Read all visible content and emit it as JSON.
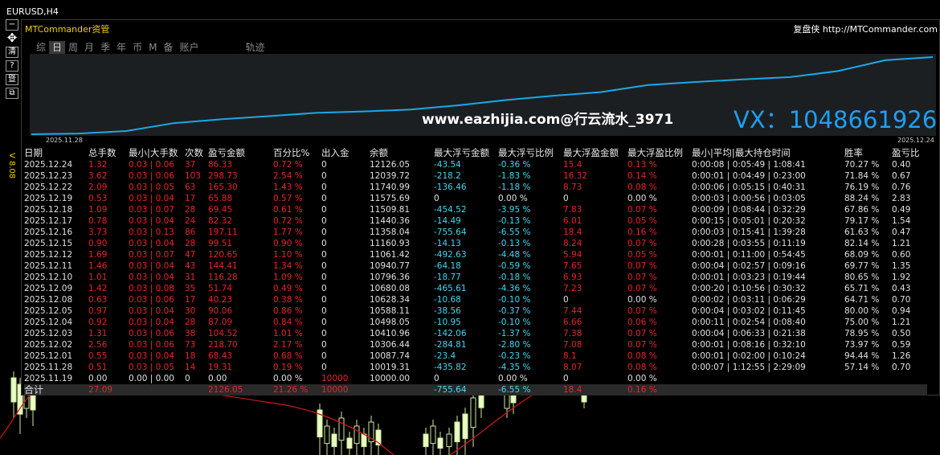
{
  "window": {
    "symbol_title": "EURUSD,H4"
  },
  "panel": {
    "title": "MTCommander资管",
    "link_prefix": "复盘侠",
    "link_url": "http://MTCommander.com",
    "version": "V 8.08"
  },
  "sidebar": {
    "buttons": [
      "−",
      "✥",
      "清",
      "?",
      "暨",
      "⧉"
    ]
  },
  "tabs": [
    {
      "label": "综",
      "active": false
    },
    {
      "label": "日",
      "active": true
    },
    {
      "label": "周",
      "active": false
    },
    {
      "label": "月",
      "active": false
    },
    {
      "label": "季",
      "active": false
    },
    {
      "label": "年",
      "active": false
    },
    {
      "label": "币",
      "active": false
    },
    {
      "label": "M",
      "active": false
    },
    {
      "label": "备",
      "active": false
    },
    {
      "label": "账户",
      "active": false
    },
    {
      "label": "轨迹",
      "active": false
    }
  ],
  "equity": {
    "start_date": "2025.11.28",
    "end_date": "2025.12.24",
    "line_color": "#1aa8e8",
    "watermark_site": "www.eazhijia.com@行云流水_3971",
    "watermark_vx": "VX：1048661926"
  },
  "table": {
    "headers": [
      "日期",
      "总手数",
      "最小|大手数",
      "次数",
      "盈亏金额",
      "百分比%",
      "出入金",
      "余额",
      "最大浮亏金额",
      "最大浮亏比例",
      "最大浮盈金额",
      "最大浮盈比例",
      "最小|平均|最大持仓时间",
      "胜率",
      "盈亏比"
    ],
    "rows": [
      [
        "2025.12.24",
        "1.32",
        "0.03 | 0.06",
        "37",
        "86.33",
        "0.72 %",
        "0",
        "12126.05",
        "-43.54",
        "-0.36 %",
        "15.4",
        "0.13 %",
        "0:00:08 | 0:05:49 | 1:08:41",
        "70.27 %",
        "0.40"
      ],
      [
        "2025.12.23",
        "3.62",
        "0.03 | 0.06",
        "103",
        "298.73",
        "2.54 %",
        "0",
        "12039.72",
        "-218.2",
        "-1.83 %",
        "16.32",
        "0.14 %",
        "0:00:01 | 0:04:49 | 0:23:00",
        "71.84 %",
        "0.67"
      ],
      [
        "2025.12.22",
        "2.09",
        "0.03 | 0.05",
        "63",
        "165.30",
        "1.43 %",
        "0",
        "11740.99",
        "-136.46",
        "-1.18 %",
        "8.73",
        "0.08 %",
        "0:00:06 | 0:05:15 | 0:40:31",
        "76.19 %",
        "0.76"
      ],
      [
        "2025.12.19",
        "0.53",
        "0.03 | 0.04",
        "17",
        "65.88",
        "0.57 %",
        "0",
        "11575.69",
        "0",
        "0.00 %",
        "0",
        "0.00 %",
        "0:00:03 | 0:00:56 | 0:03:05",
        "88.24 %",
        "2.83"
      ],
      [
        "2025.12.18",
        "1.09",
        "0.03 | 0.07",
        "28",
        "69.45",
        "0.61 %",
        "0",
        "11509.81",
        "-454.52",
        "-3.95 %",
        "7.83",
        "0.07 %",
        "0:00:09 | 0:08:44 | 0:32:29",
        "67.86 %",
        "0.49"
      ],
      [
        "2025.12.17",
        "0.78",
        "0.03 | 0.04",
        "24",
        "82.32",
        "0.72 %",
        "0",
        "11440.36",
        "-14.49",
        "-0.13 %",
        "6.01",
        "0.05 %",
        "0:00:15 | 0:05:01 | 0:20:32",
        "79.17 %",
        "1.54"
      ],
      [
        "2025.12.16",
        "3.73",
        "0.03 | 0.13",
        "86",
        "197.11",
        "1.77 %",
        "0",
        "11358.04",
        "-755.64",
        "-6.55 %",
        "18.4",
        "0.16 %",
        "0:00:03 | 0:15:41 | 1:39:28",
        "61.63 %",
        "0.47"
      ],
      [
        "2025.12.15",
        "0.90",
        "0.03 | 0.04",
        "28",
        "99.51",
        "0.90 %",
        "0",
        "11160.93",
        "-14.13",
        "-0.13 %",
        "8.24",
        "0.07 %",
        "0:00:28 | 0:03:55 | 0:11:19",
        "82.14 %",
        "1.21"
      ],
      [
        "2025.12.12",
        "1.69",
        "0.03 | 0.07",
        "47",
        "120.65",
        "1.10 %",
        "0",
        "11061.42",
        "-492.63",
        "-4.48 %",
        "5.94",
        "0.05 %",
        "0:00:01 | 0:11:00 | 0:54:45",
        "68.09 %",
        "0.60"
      ],
      [
        "2025.12.11",
        "1.46",
        "0.03 | 0.04",
        "43",
        "144.41",
        "1.34 %",
        "0",
        "10940.77",
        "-64.18",
        "-0.59 %",
        "7.65",
        "0.07 %",
        "0:00:04 | 0:02:57 | 0:09:16",
        "69.77 %",
        "1.35"
      ],
      [
        "2025.12.10",
        "1.01",
        "0.03 | 0.04",
        "31",
        "116.28",
        "1.09 %",
        "0",
        "10796.36",
        "-18.77",
        "-0.18 %",
        "6.93",
        "0.07 %",
        "0:00:01 | 0:03:23 | 0:19:44",
        "80.65 %",
        "1.92"
      ],
      [
        "2025.12.09",
        "1.42",
        "0.03 | 0.08",
        "35",
        "51.74",
        "0.49 %",
        "0",
        "10680.08",
        "-465.61",
        "-4.36 %",
        "7.23",
        "0.07 %",
        "0:00:20 | 0:10:56 | 0:30:32",
        "65.71 %",
        "0.43"
      ],
      [
        "2025.12.08",
        "0.63",
        "0.03 | 0.06",
        "17",
        "40.23",
        "0.38 %",
        "0",
        "10628.34",
        "-10.68",
        "-0.10 %",
        "0",
        "0.00 %",
        "0:00:02 | 0:03:11 | 0:06:29",
        "64.71 %",
        "0.70"
      ],
      [
        "2025.12.05",
        "0.97",
        "0.03 | 0.04",
        "30",
        "90.06",
        "0.86 %",
        "0",
        "10588.11",
        "-38.56",
        "-0.37 %",
        "7.44",
        "0.07 %",
        "0:00:04 | 0:03:02 | 0:11:45",
        "80.00 %",
        "0.94"
      ],
      [
        "2025.12.04",
        "0.92",
        "0.03 | 0.04",
        "28",
        "87.09",
        "0.84 %",
        "0",
        "10498.05",
        "-10.95",
        "-0.10 %",
        "6.66",
        "0.06 %",
        "0:00:11 | 0:02:54 | 0:08:40",
        "75.00 %",
        "1.21"
      ],
      [
        "2025.12.03",
        "1.31",
        "0.03 | 0.06",
        "38",
        "104.52",
        "1.01 %",
        "0",
        "10410.96",
        "-142.06",
        "-1.37 %",
        "7.38",
        "0.07 %",
        "0:00:04 | 0:06:33 | 0:21:38",
        "78.95 %",
        "0.50"
      ],
      [
        "2025.12.02",
        "2.56",
        "0.03 | 0.06",
        "73",
        "218.70",
        "2.17 %",
        "0",
        "10306.44",
        "-284.81",
        "-2.80 %",
        "7.08",
        "0.07 %",
        "0:00:01 | 0:08:16 | 0:32:10",
        "73.97 %",
        "0.59"
      ],
      [
        "2025.12.01",
        "0.55",
        "0.03 | 0.04",
        "18",
        "68.43",
        "0.68 %",
        "0",
        "10087.74",
        "-23.4",
        "-0.23 %",
        "8.1",
        "0.08 %",
        "0:00:01 | 0:02:00 | 0:10:24",
        "94.44 %",
        "1.26"
      ],
      [
        "2025.11.28",
        "0.51",
        "0.03 | 0.05",
        "14",
        "19.31",
        "0.19 %",
        "0",
        "10019.31",
        "-435.82",
        "-4.35 %",
        "8.07",
        "0.08 %",
        "0:00:07 | 1:12:55 | 2:29:09",
        "57.14 %",
        "0.70"
      ],
      [
        "2025.11.19",
        "0.00",
        "0.00 | 0.00",
        "0",
        "0.00",
        "0.00 %",
        "10000",
        "10000.00",
        "0",
        "0.00 %",
        "0",
        "0.00 %",
        "",
        "",
        ""
      ]
    ],
    "total": [
      "合计",
      "27.09",
      "",
      "",
      "2126.05",
      "21.26 %",
      "10000",
      "",
      "-755.64",
      "-6.55 %",
      "18.4",
      "0.16 %",
      "",
      "",
      ""
    ]
  },
  "colors": {
    "loss": "#e8232a",
    "float": "#40d8f0",
    "text": "#e0e0e0",
    "title": "#f0d000"
  }
}
